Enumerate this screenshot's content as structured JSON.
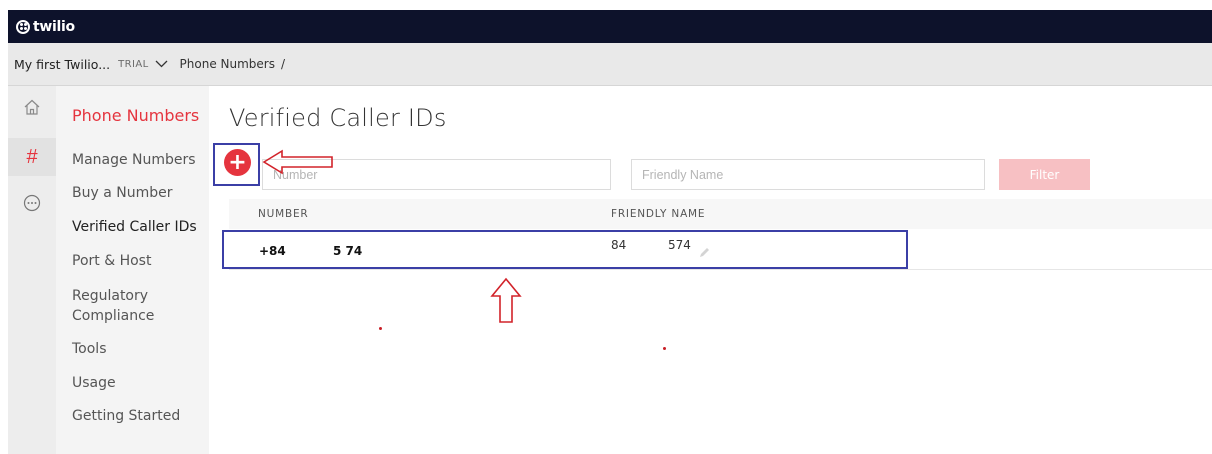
{
  "brand": {
    "logo_text": "twilio"
  },
  "account_bar": {
    "account_name": "My first Twilio...",
    "badge": "TRIAL",
    "chevron": "chevron-down-icon",
    "breadcrumb": "Phone Numbers",
    "separator": "/"
  },
  "rail": {
    "items": [
      {
        "name": "home-icon",
        "active": false
      },
      {
        "name": "hash-icon",
        "glyph": "#",
        "active": true
      },
      {
        "name": "more-icon",
        "active": false
      }
    ]
  },
  "sidebar": {
    "title": "Phone Numbers",
    "items": [
      "Manage Numbers",
      "Buy a Number",
      "Verified Caller IDs",
      "Port & Host",
      "Regulatory",
      "Compliance",
      "Tools",
      "Usage",
      "Getting Started"
    ]
  },
  "main": {
    "title": "Verified Caller IDs",
    "add_glyph": "+",
    "number_placeholder": "Number",
    "friendly_placeholder": "Friendly Name",
    "filter_label": "Filter",
    "columns": [
      "NUMBER",
      "FRIENDLY NAME"
    ],
    "rows": [
      {
        "number_prefix": "+84",
        "number_suffix": "5 74",
        "friendly_prefix": "84",
        "friendly_suffix": "574"
      }
    ]
  },
  "colors": {
    "brand_bar": "#0d122b",
    "accent_red": "#e5343e",
    "annotation_blue": "#3b3fa6"
  }
}
